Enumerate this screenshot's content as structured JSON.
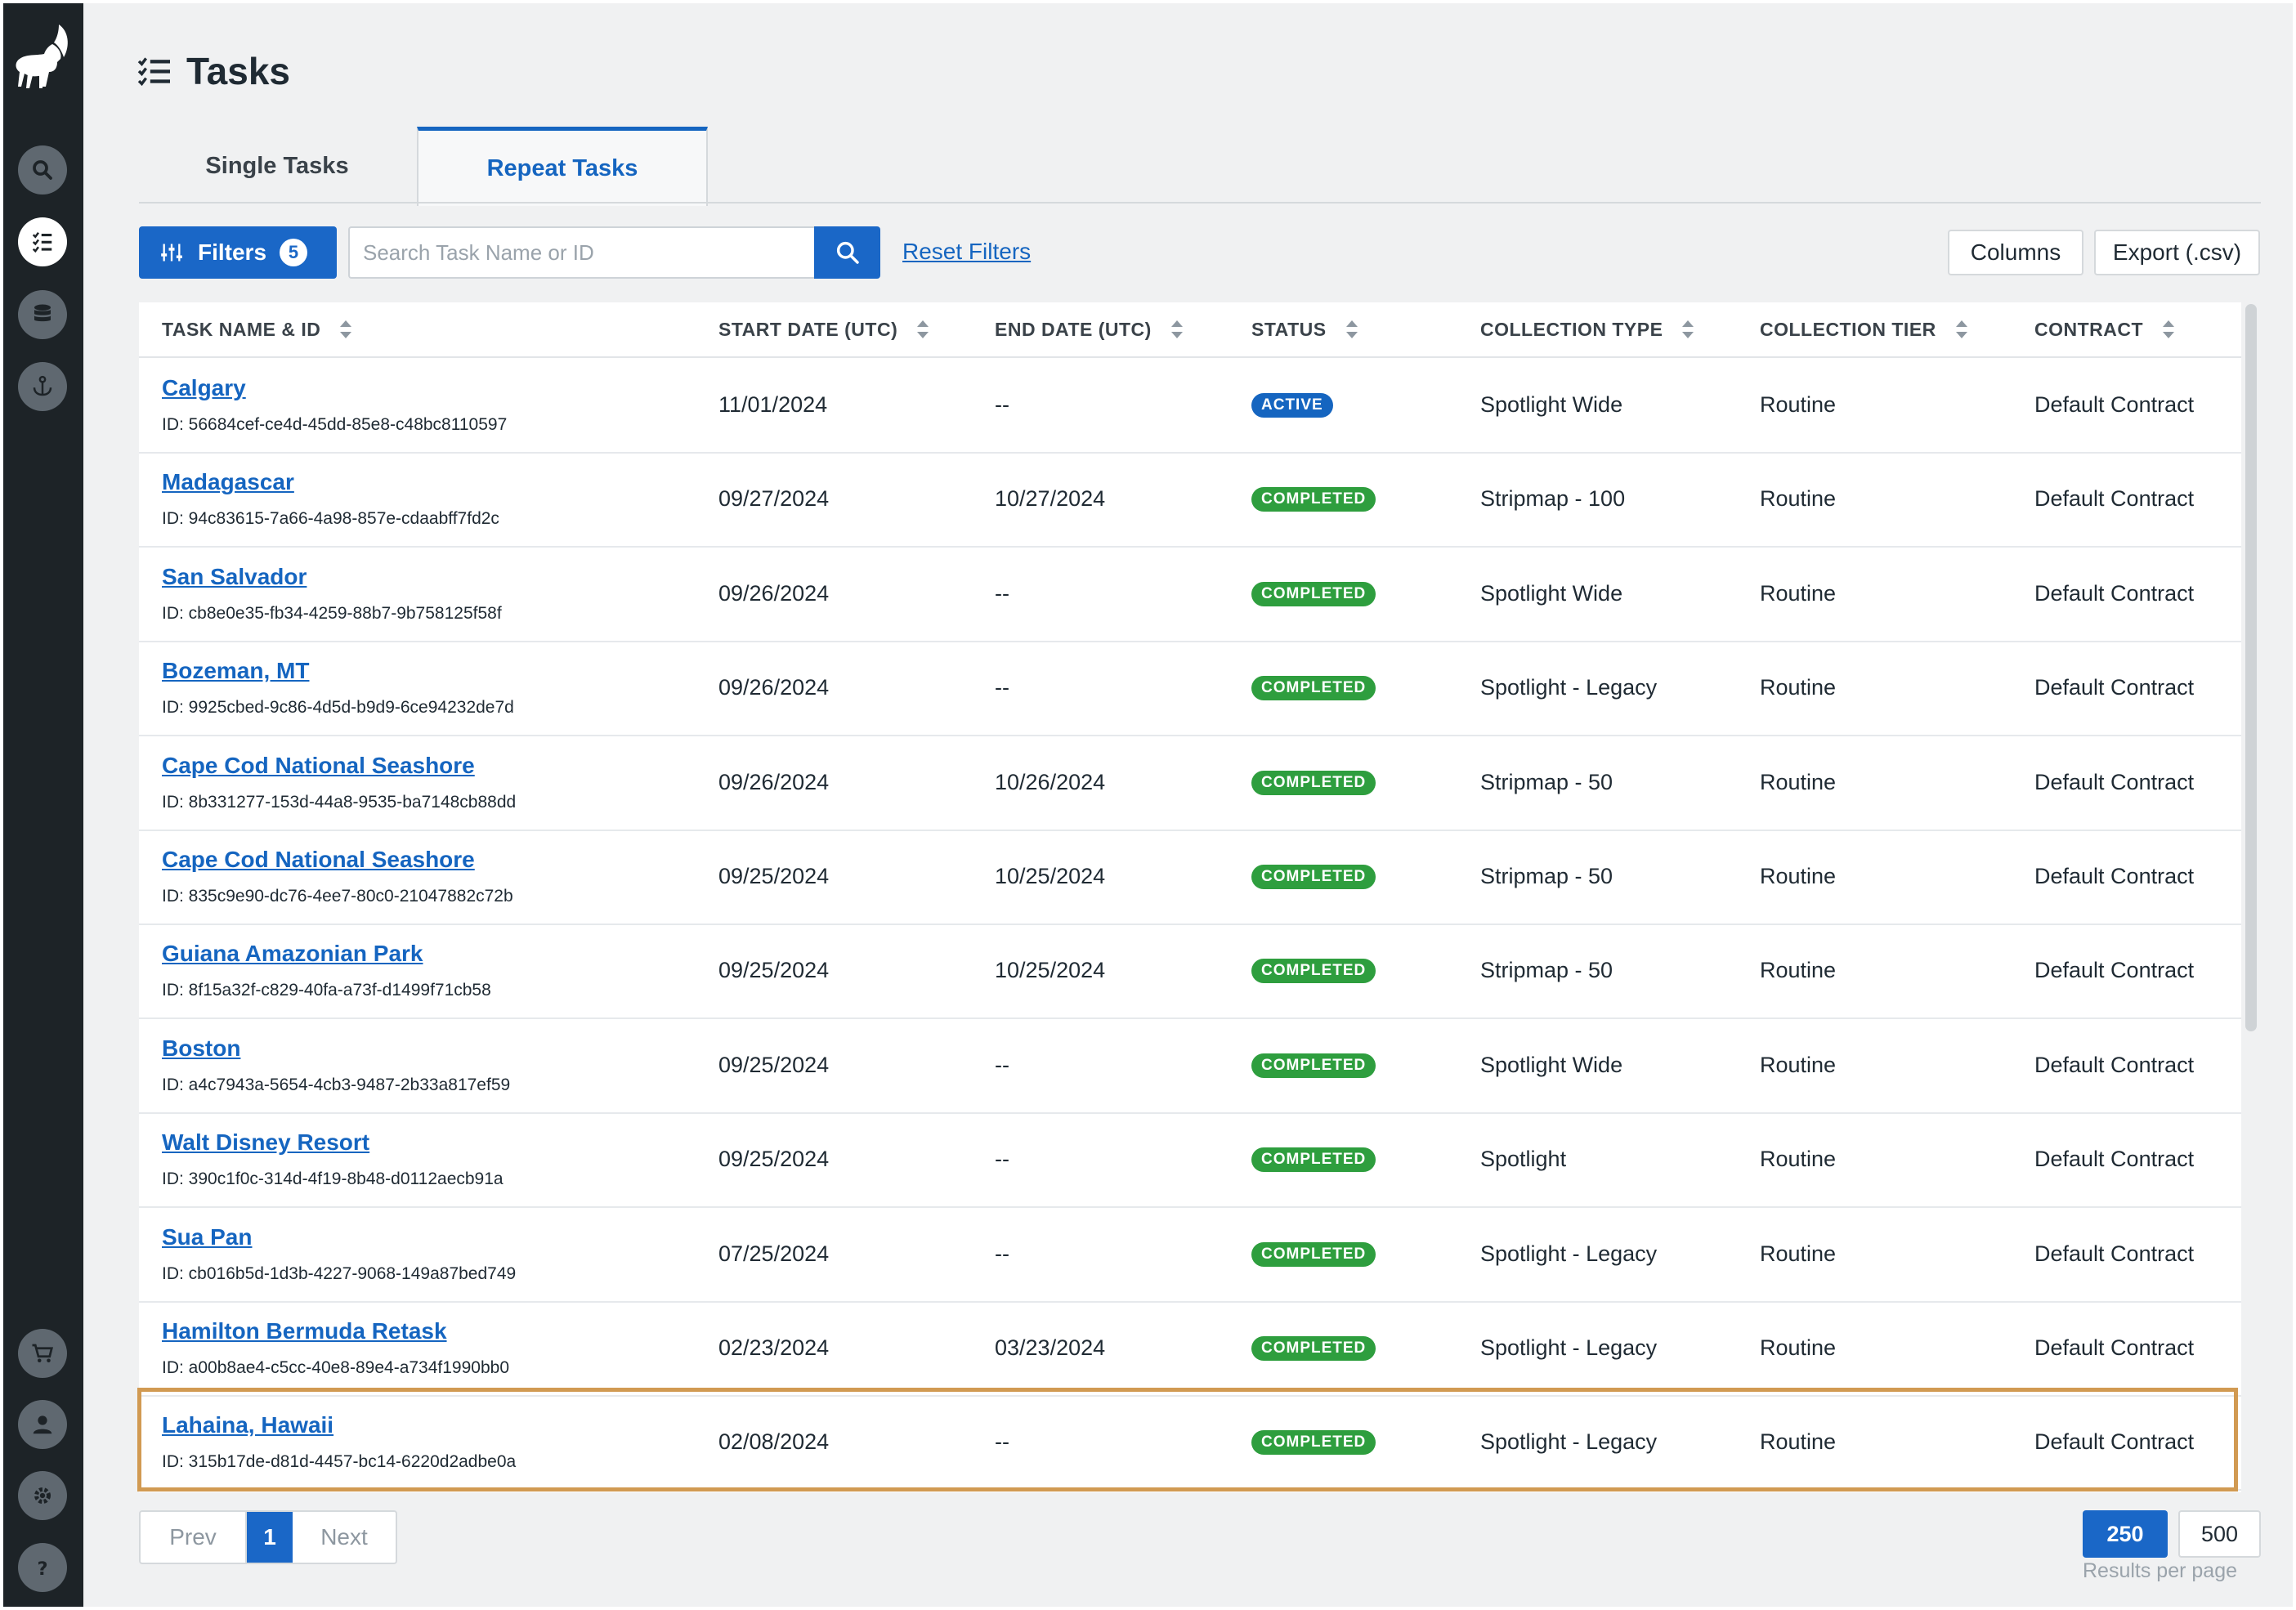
{
  "page": {
    "title": "Tasks"
  },
  "tabs": {
    "single": "Single Tasks",
    "repeat": "Repeat Tasks"
  },
  "toolbar": {
    "filters_label": "Filters",
    "filters_count": "5",
    "search_placeholder": "Search Task Name or ID",
    "reset_label": "Reset Filters",
    "columns_label": "Columns",
    "export_label": "Export (.csv)"
  },
  "table": {
    "headers": [
      "TASK NAME & ID",
      "START DATE (UTC)",
      "END DATE (UTC)",
      "STATUS",
      "COLLECTION TYPE",
      "COLLECTION TIER",
      "CONTRACT"
    ],
    "rows": [
      {
        "name": "Calgary",
        "id": "ID: 56684cef-ce4d-45dd-85e8-c48bc8110597",
        "start": "11/01/2024",
        "end": "--",
        "status": "ACTIVE",
        "type": "Spotlight Wide",
        "tier": "Routine",
        "contract": "Default Contract"
      },
      {
        "name": "Madagascar",
        "id": "ID: 94c83615-7a66-4a98-857e-cdaabff7fd2c",
        "start": "09/27/2024",
        "end": "10/27/2024",
        "status": "COMPLETED",
        "type": "Stripmap - 100",
        "tier": "Routine",
        "contract": "Default Contract"
      },
      {
        "name": "San Salvador",
        "id": "ID: cb8e0e35-fb34-4259-88b7-9b758125f58f",
        "start": "09/26/2024",
        "end": "--",
        "status": "COMPLETED",
        "type": "Spotlight Wide",
        "tier": "Routine",
        "contract": "Default Contract"
      },
      {
        "name": "Bozeman, MT",
        "id": "ID: 9925cbed-9c86-4d5d-b9d9-6ce94232de7d",
        "start": "09/26/2024",
        "end": "--",
        "status": "COMPLETED",
        "type": "Spotlight - Legacy",
        "tier": "Routine",
        "contract": "Default Contract"
      },
      {
        "name": "Cape Cod National Seashore",
        "id": "ID: 8b331277-153d-44a8-9535-ba7148cb88dd",
        "start": "09/26/2024",
        "end": "10/26/2024",
        "status": "COMPLETED",
        "type": "Stripmap - 50",
        "tier": "Routine",
        "contract": "Default Contract"
      },
      {
        "name": "Cape Cod National Seashore",
        "id": "ID: 835c9e90-dc76-4ee7-80c0-21047882c72b",
        "start": "09/25/2024",
        "end": "10/25/2024",
        "status": "COMPLETED",
        "type": "Stripmap - 50",
        "tier": "Routine",
        "contract": "Default Contract"
      },
      {
        "name": "Guiana Amazonian Park",
        "id": "ID: 8f15a32f-c829-40fa-a73f-d1499f71cb58",
        "start": "09/25/2024",
        "end": "10/25/2024",
        "status": "COMPLETED",
        "type": "Stripmap - 50",
        "tier": "Routine",
        "contract": "Default Contract"
      },
      {
        "name": "Boston",
        "id": "ID: a4c7943a-5654-4cb3-9487-2b33a817ef59",
        "start": "09/25/2024",
        "end": "--",
        "status": "COMPLETED",
        "type": "Spotlight Wide",
        "tier": "Routine",
        "contract": "Default Contract"
      },
      {
        "name": "Walt Disney Resort",
        "id": "ID: 390c1f0c-314d-4f19-8b48-d0112aecb91a",
        "start": "09/25/2024",
        "end": "--",
        "status": "COMPLETED",
        "type": "Spotlight",
        "tier": "Routine",
        "contract": "Default Contract"
      },
      {
        "name": "Sua Pan",
        "id": "ID: cb016b5d-1d3b-4227-9068-149a87bed749",
        "start": "07/25/2024",
        "end": "--",
        "status": "COMPLETED",
        "type": "Spotlight - Legacy",
        "tier": "Routine",
        "contract": "Default Contract"
      },
      {
        "name": "Hamilton Bermuda Retask",
        "id": "ID: a00b8ae4-c5cc-40e8-89e4-a734f1990bb0",
        "start": "02/23/2024",
        "end": "03/23/2024",
        "status": "COMPLETED",
        "type": "Spotlight - Legacy",
        "tier": "Routine",
        "contract": "Default Contract"
      },
      {
        "name": "Lahaina, Hawaii",
        "id": "ID: 315b17de-d81d-4457-bc14-6220d2adbe0a",
        "start": "02/08/2024",
        "end": "--",
        "status": "COMPLETED",
        "type": "Spotlight - Legacy",
        "tier": "Routine",
        "contract": "Default Contract"
      }
    ]
  },
  "pagination": {
    "prev": "Prev",
    "page": "1",
    "next": "Next"
  },
  "per_page": {
    "option_a": "250",
    "option_b": "500",
    "label": "Results per page"
  },
  "colors": {
    "accent": "#1a67c7",
    "active_badge": "#1565c0",
    "completed_badge": "#2e9e3e",
    "highlight": "#d19a52",
    "sidebar": "#1d2327"
  },
  "icons": [
    "ibex-logo",
    "search-icon",
    "task-list-icon",
    "database-icon",
    "anchor-icon",
    "cart-icon",
    "user-icon",
    "gear-icon",
    "help-icon",
    "filter-sliders-icon",
    "magnifier-icon"
  ]
}
